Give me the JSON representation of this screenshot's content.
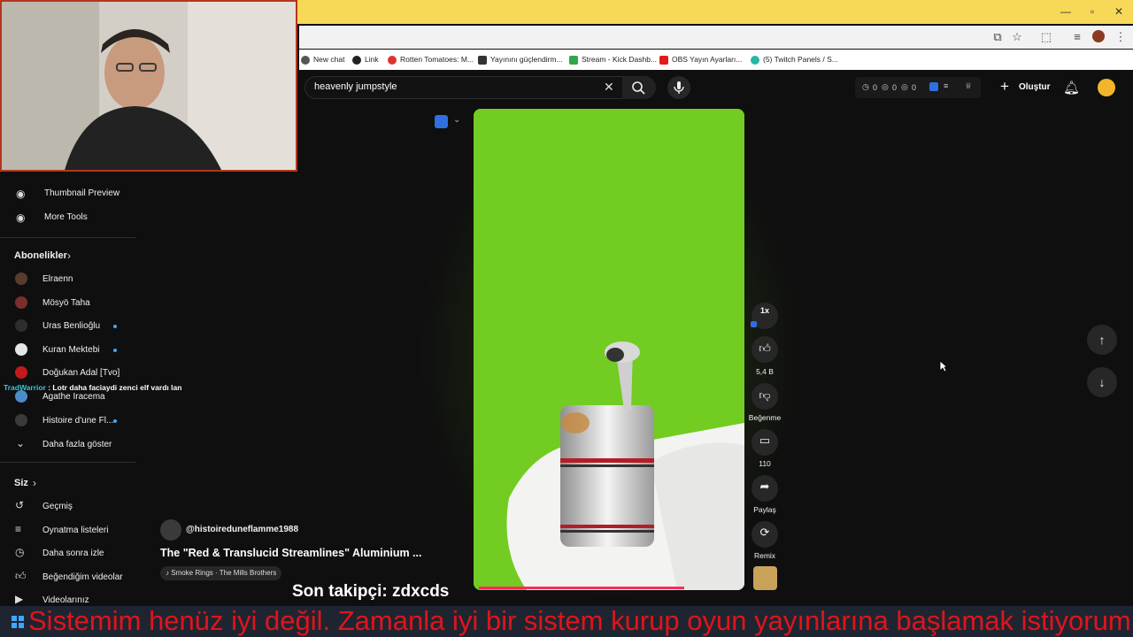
{
  "bookmarks": [
    "New chat",
    "Link",
    "Rotten Tomatoes: M...",
    "Yayınını güçlendirm...",
    "Stream - Kick Dashb...",
    "OBS Yayın Ayarları...",
    "(5) Twitch Panels / S..."
  ],
  "search": {
    "query": "heavenly jumpstyle"
  },
  "header": {
    "stat1": "0",
    "stat2": "0",
    "stat3": "0",
    "create_label": "Oluştur"
  },
  "sidebar": {
    "tools": [
      {
        "label": "Thumbnail Preview"
      },
      {
        "label": "More Tools"
      }
    ],
    "subs_header": "Abonelikler",
    "subs": [
      {
        "label": "Elraenn"
      },
      {
        "label": "Mösyö Taha"
      },
      {
        "label": "Uras Benlioğlu"
      },
      {
        "label": "Kuran Mektebi"
      },
      {
        "label": "Doğukan Adal [Tvo]"
      },
      {
        "label": "Agathe Iracema"
      },
      {
        "label": "Histoire d'une Fl..."
      }
    ],
    "show_more": "Daha fazla göster",
    "you_header": "Siz",
    "you": [
      {
        "label": "Geçmiş"
      },
      {
        "label": "Oynatma listeleri"
      },
      {
        "label": "Daha sonra izle"
      },
      {
        "label": "Beğendiğim videolar"
      },
      {
        "label": "Videolarınız"
      }
    ]
  },
  "chat": {
    "user": "TradWarrior",
    "message": " : Lotr daha faciaydi zenci elf vardı lan"
  },
  "short": {
    "channel": "@histoireduneflamme1988",
    "title": "The \"Red & Translucid Streamlines\" Aluminium ...",
    "music": "Smoke Rings · The Mills Brothers",
    "speed": "1x",
    "likes": "5,4 B",
    "dislike_label": "Beğenme",
    "comments": "110",
    "share_label": "Paylaş",
    "remix_label": "Remix"
  },
  "overlay": {
    "last_follower": "Son takipçi: zdxcds",
    "ticker": "Sistemim henüz iyi değil. Zamanla iyi bir sistem kurup oyun yayınlarına başlamak istiyorum"
  },
  "colors": {
    "accent": "#3ea6ff",
    "titlebar": "#f7d957",
    "webcam_border": "#b3361d",
    "ticker_red": "#e0141c"
  }
}
